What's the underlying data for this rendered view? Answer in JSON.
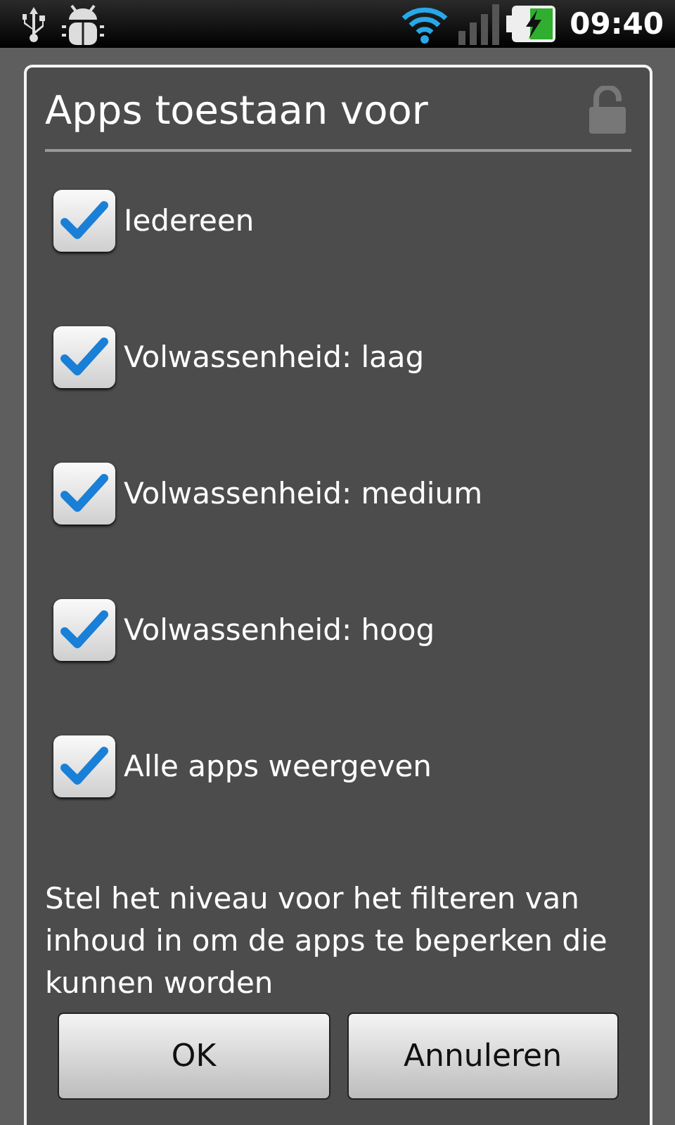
{
  "status_bar": {
    "time": "09:40"
  },
  "dialog": {
    "title": "Apps toestaan voor",
    "options": [
      {
        "label": "Iedereen",
        "checked": true
      },
      {
        "label": "Volwassenheid: laag",
        "checked": true
      },
      {
        "label": "Volwassenheid: medium",
        "checked": true
      },
      {
        "label": "Volwassenheid: hoog",
        "checked": true
      },
      {
        "label": "Alle apps weergeven",
        "checked": true
      }
    ],
    "message": "Stel het niveau voor het filteren van inhoud in om de apps te beperken die kunnen worden",
    "buttons": [
      "OK",
      "Annuleren"
    ]
  }
}
